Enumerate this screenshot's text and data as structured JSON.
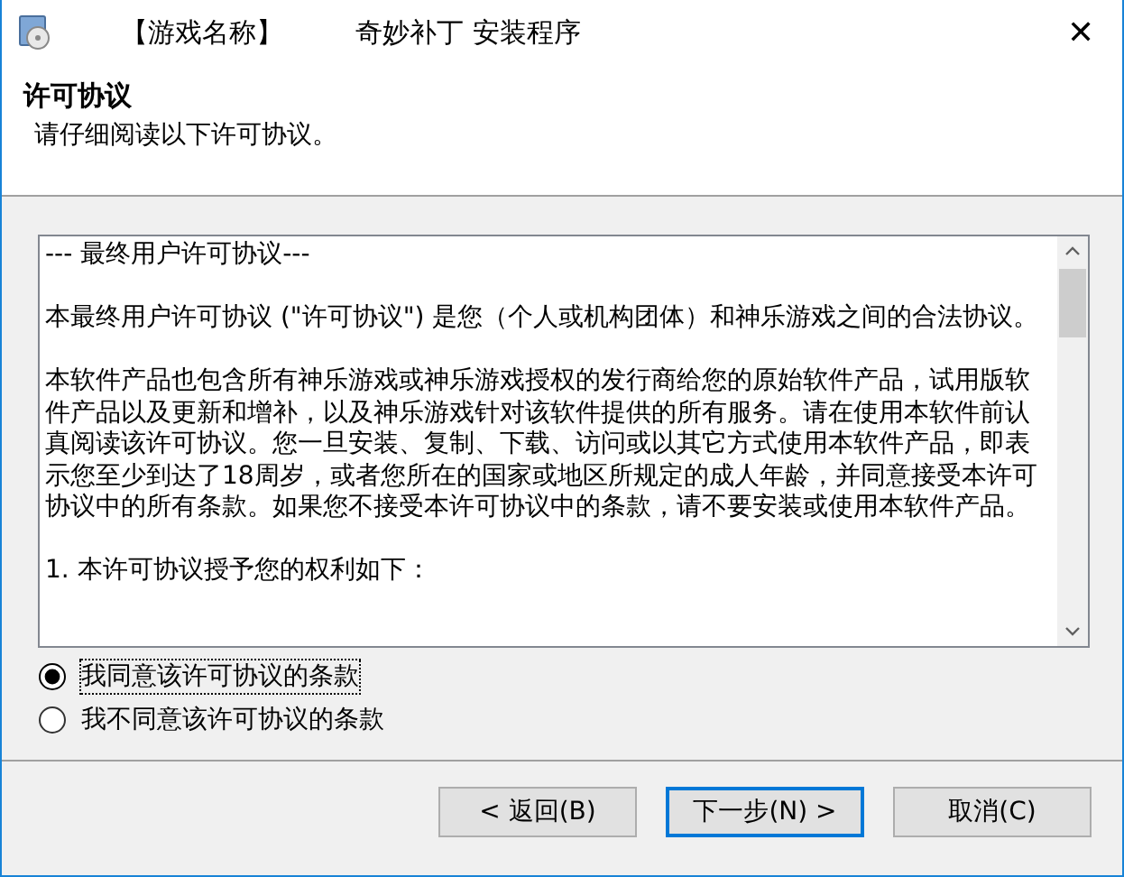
{
  "window": {
    "title_parts": [
      "【游戏名称】",
      "奇妙补丁 安装程序"
    ],
    "close": "✕"
  },
  "header": {
    "title": "许可协议",
    "subtitle": "请仔细阅读以下许可协议。"
  },
  "license": {
    "paragraphs": [
      "--- 最终用户许可协议---",
      "本最终用户许可协议 (\"许可协议\") 是您（个人或机构团体）和神乐游戏之间的合法协议。",
      "本软件产品也包含所有神乐游戏或神乐游戏授权的发行商给您的原始软件产品，试用版软件产品以及更新和增补，以及神乐游戏针对该软件提供的所有服务。请在使用本软件前认真阅读该许可协议。您一旦安装、复制、下载、访问或以其它方式使用本软件产品，即表示您至少到达了18周岁，或者您所在的国家或地区所规定的成人年龄，并同意接受本许可协议中的所有条款。如果您不接受本许可协议中的条款，请不要安装或使用本软件产品。",
      "1. 本许可协议授予您的权利如下："
    ]
  },
  "options": [
    {
      "label": "我同意该许可协议的条款",
      "selected": true
    },
    {
      "label": "我不同意该许可协议的条款",
      "selected": false
    }
  ],
  "buttons": [
    {
      "label": "< 返回(B)",
      "kind": "back"
    },
    {
      "label": "下一步(N) >",
      "kind": "next"
    },
    {
      "label": "取消(C)",
      "kind": "cancel"
    }
  ]
}
